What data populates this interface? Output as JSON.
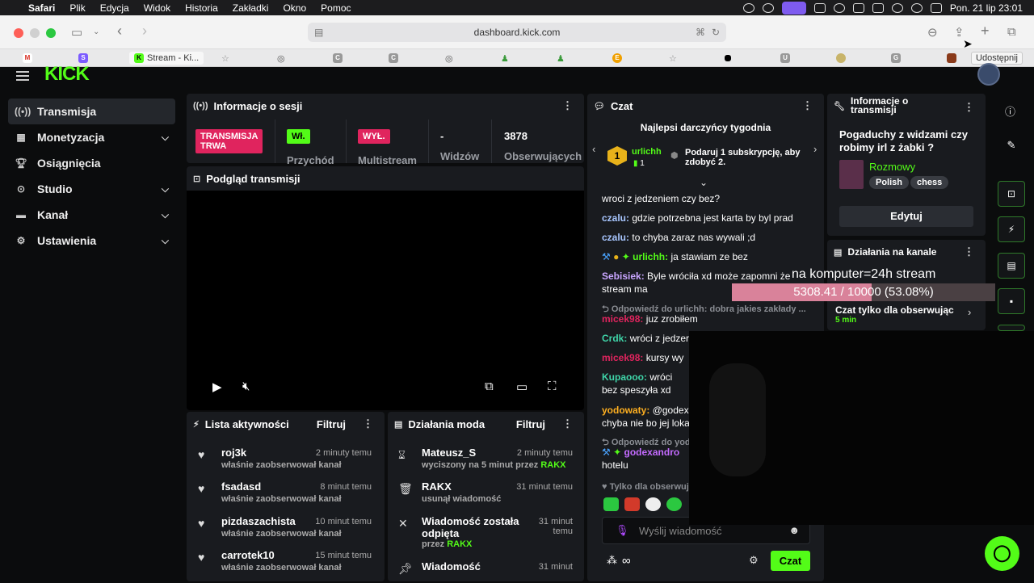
{
  "menubar": {
    "app": "Safari",
    "items": [
      "Plik",
      "Edycja",
      "Widok",
      "Historia",
      "Zakładki",
      "Okno",
      "Pomoc"
    ],
    "datetime": "Pon. 21 lip  23:01"
  },
  "browser": {
    "url": "dashboard.kick.com",
    "tooltip": "Udostępnij",
    "active_tab": "Stream - Ki..."
  },
  "sidebar": {
    "items": [
      {
        "label": "Transmisja",
        "icon": "broadcast-icon",
        "expand": false
      },
      {
        "label": "Monetyzacja",
        "icon": "money-icon",
        "expand": true
      },
      {
        "label": "Osiągnięcia",
        "icon": "trophy-icon",
        "expand": false
      },
      {
        "label": "Studio",
        "icon": "studio-icon",
        "expand": true
      },
      {
        "label": "Kanał",
        "icon": "channel-icon",
        "expand": true
      },
      {
        "label": "Ustawienia",
        "icon": "gear-icon",
        "expand": true
      }
    ]
  },
  "session": {
    "title": "Informacje o sesji",
    "live_badge": "TRANSMISJA TRWA",
    "entry_badge": "Wł.",
    "entry_label": "Przychód",
    "multistream_badge": "WYŁ.",
    "multistream_label": "Multistream",
    "viewers_value": "-",
    "viewers_label": "Widzów",
    "followers_value": "3878",
    "followers_label": "Obserwujących"
  },
  "preview": {
    "title": "Podgląd transmisji"
  },
  "activity": {
    "title": "Lista aktywności",
    "filter": "Filtruj",
    "items": [
      {
        "name": "roj3k",
        "desc": "właśnie zaobserwował kanał",
        "time": "2 minuty temu"
      },
      {
        "name": "fsadasd",
        "desc": "właśnie zaobserwował kanał",
        "time": "8 minut temu"
      },
      {
        "name": "pizdaszachista",
        "desc": "właśnie zaobserwował kanał",
        "time": "10 minut temu"
      },
      {
        "name": "carrotek10",
        "desc": "właśnie zaobserwował kanał",
        "time": "15 minut temu"
      }
    ]
  },
  "modactions": {
    "title": "Działania moda",
    "filter": "Filtruj",
    "items": [
      {
        "name": "Mateusz_S",
        "desc": "wyciszony na 5 minut przez",
        "by": "RAKX",
        "time": "2 minuty temu"
      },
      {
        "name": "RAKX",
        "desc": "usunął wiadomość",
        "by": "",
        "time": "31 minut temu"
      },
      {
        "name": "Wiadomość została odpięta",
        "desc": "przez",
        "by": "RAKX",
        "time": "31 minut temu"
      },
      {
        "name": "Wiadomość",
        "desc": "",
        "by": "",
        "time": "31 minut"
      }
    ]
  },
  "chat": {
    "title": "Czat",
    "top_gifters": "Najlepsi darczyńcy tygodnia",
    "gifter_name": "urlichh",
    "gifter_count": "1",
    "gift_prompt": "Podaruj 1 subskrypcję, aby zdobyć 2.",
    "messages": [
      {
        "user": "",
        "text": "wroci z jedzeniem czy bez?",
        "color": "#ffffff"
      },
      {
        "user": "czalu:",
        "text": "gdzie potrzebna jest karta by byl prad",
        "color": "#a8c6ff"
      },
      {
        "user": "czalu:",
        "text": "to chyba zaraz nas wywali ;d",
        "color": "#a8c6ff"
      },
      {
        "user": "urlichh:",
        "text": "ja stawiam ze bez",
        "color": "#53fc18"
      },
      {
        "user": "Sebisiek:",
        "text": "Byle wróciła xd może zapomni że stream ma",
        "color": "#c9a6ff"
      },
      {
        "user": "micek98:",
        "text": "juz zrobiłem",
        "color": "#e0245e"
      },
      {
        "user": "Crdk:",
        "text": "wróci z jedzer",
        "color": "#3fd4a8"
      },
      {
        "user": "micek98:",
        "text": "kursy wy",
        "color": "#e0245e"
      },
      {
        "user": "Kupaooo:",
        "text": "wróci bez speszyła xd",
        "color": "#3fd4a8"
      },
      {
        "user": "yodowaty:",
        "text": "@godex chyba nie bo jej loka",
        "color": "#ffb020"
      },
      {
        "user": "godexandro",
        "text": "hotelu",
        "color": "#c46bff"
      }
    ],
    "reply1": "Odpowiedź do urlichh: dobra jakies zakłady ...",
    "reply2": "Odpowiedź do yod",
    "followers_only": "Tylko dla obserwuj",
    "input_placeholder": "Wyślij wiadomość",
    "send": "Czat"
  },
  "streaminfo": {
    "title": "Informacje o transmisji",
    "stream_title": "Pogaduchy z widzami czy robimy irl z żabki ?",
    "category": "Rozmowy",
    "tags": [
      "Polish",
      "chess"
    ],
    "edit": "Edytuj"
  },
  "channelactions": {
    "title": "Działania na kanale",
    "followers_only": "Czat tylko dla obserwując",
    "duration": "5 min"
  },
  "overlay": {
    "text": "na komputer=24h stream",
    "progress_text": "5308.41 / 10000 (53.08%)",
    "progress_fraction": 0.5308
  }
}
